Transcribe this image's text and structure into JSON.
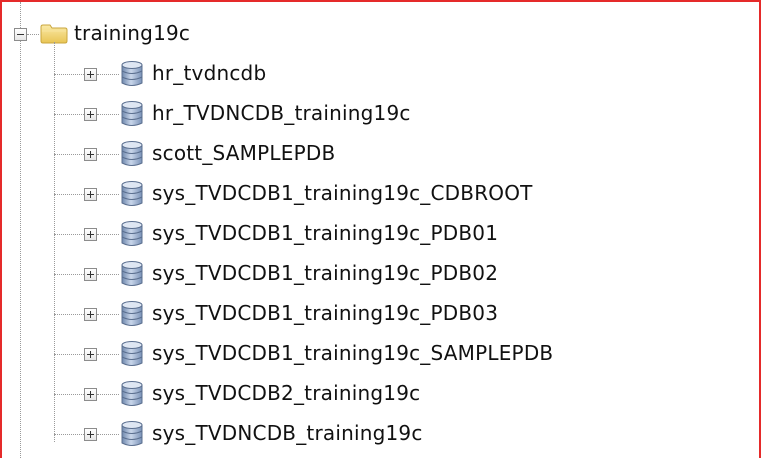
{
  "tree": {
    "root": {
      "label": "training19c",
      "expanded": true,
      "icon": "folder-icon"
    },
    "children": [
      {
        "label": "hr_tvdncdb",
        "icon": "database-icon"
      },
      {
        "label": "hr_TVDNCDB_training19c",
        "icon": "database-icon"
      },
      {
        "label": "scott_SAMPLEPDB",
        "icon": "database-icon"
      },
      {
        "label": "sys_TVDCDB1_training19c_CDBROOT",
        "icon": "database-icon"
      },
      {
        "label": "sys_TVDCDB1_training19c_PDB01",
        "icon": "database-icon"
      },
      {
        "label": "sys_TVDCDB1_training19c_PDB02",
        "icon": "database-icon"
      },
      {
        "label": "sys_TVDCDB1_training19c_PDB03",
        "icon": "database-icon"
      },
      {
        "label": "sys_TVDCDB1_training19c_SAMPLEPDB",
        "icon": "database-icon"
      },
      {
        "label": "sys_TVDCDB2_training19c",
        "icon": "database-icon"
      },
      {
        "label": "sys_TVDNCDB_training19c",
        "icon": "database-icon"
      }
    ]
  },
  "colors": {
    "frame_border": "#e52a2a",
    "folder": "#f2d36b",
    "database": "#8fa7c8"
  }
}
